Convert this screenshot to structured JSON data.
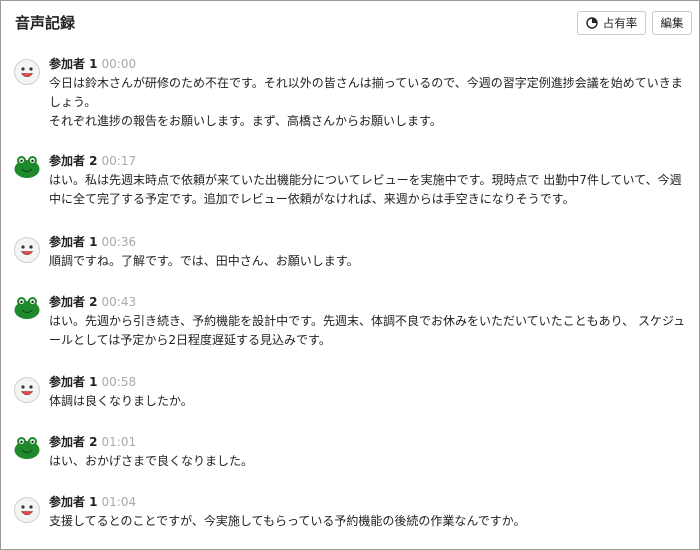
{
  "header": {
    "title": "音声記録",
    "occupancy_button": "占有率",
    "edit_button": "編集"
  },
  "entries": [
    {
      "speaker": "参加者 1",
      "time": "00:00",
      "avatar": "white-avatar-icon",
      "lines": [
        "今日は鈴木さんが研修のため不在です。それ以外の皆さんは揃っているので、今週の習字定例進捗会議を始めていきましょう。",
        "それぞれ進捗の報告をお願いします。まず、高橋さんからお願いします。"
      ]
    },
    {
      "speaker": "参加者 2",
      "time": "00:17",
      "avatar": "green-frog-avatar-icon",
      "lines": [
        "はい。私は先週末時点で依頼が来ていた出機能分についてレビューを実施中です。現時点で 出勤中7件していて、今週中に全て完了する予定です。追加でレビュー依頼がなければ、来週からは手空きになりそうです。"
      ]
    },
    {
      "speaker": "参加者 1",
      "time": "00:36",
      "avatar": "white-avatar-icon",
      "lines": [
        "順調ですね。了解です。では、田中さん、お願いします。"
      ]
    },
    {
      "speaker": "参加者 2",
      "time": "00:43",
      "avatar": "green-frog-avatar-icon",
      "lines": [
        "はい。先週から引き続き、予約機能を設計中です。先週末、体調不良でお休みをいただいていたこともあり、 スケジュールとしては予定から2日程度遅延する見込みです。"
      ]
    },
    {
      "speaker": "参加者 1",
      "time": "00:58",
      "avatar": "white-avatar-icon",
      "lines": [
        "体調は良くなりましたか。"
      ]
    },
    {
      "speaker": "参加者 2",
      "time": "01:01",
      "avatar": "green-frog-avatar-icon",
      "lines": [
        "はい、おかげさまで良くなりました。"
      ]
    },
    {
      "speaker": "参加者 1",
      "time": "01:04",
      "avatar": "white-avatar-icon",
      "lines": [
        "支援してるとのことですが、今実施してもらっている予約機能の後続の作業なんですか。"
      ]
    }
  ]
}
